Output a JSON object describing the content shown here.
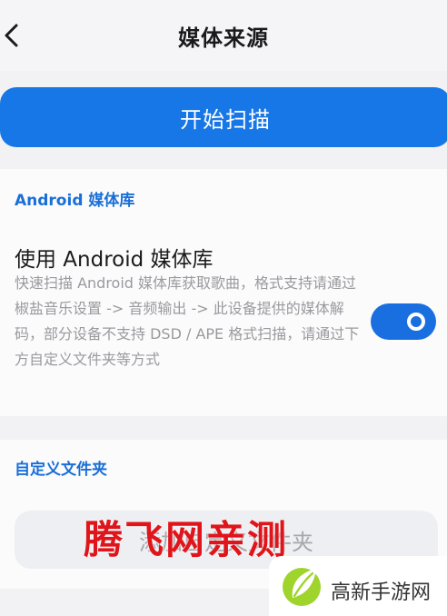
{
  "header": {
    "title": "媒体来源",
    "back_icon": "chevron-left-icon"
  },
  "scan": {
    "label": "开始扫描",
    "color": "#1877e6"
  },
  "android_section": {
    "label": "Android 媒体库",
    "setting_title": "使用 Android 媒体库",
    "description": "快速扫描 Android 媒体库获取歌曲，格式支持请通过椒盐音乐设置 -> 音频输出 -> 此设备提供的媒体解码，部分设备不支持 DSD / APE 格式扫描，请通过下方自定义文件夹等方式",
    "toggle_on": true,
    "toggle_color": "#1a6fe0"
  },
  "folder_section": {
    "label": "自定义文件夹",
    "add_button": "添加自定义文件夹"
  },
  "watermark": {
    "text": "腾飞网亲测",
    "color": "#e0151b"
  },
  "brand": {
    "name": "高新手游网",
    "logo_icon": "leaf-logo-icon"
  }
}
